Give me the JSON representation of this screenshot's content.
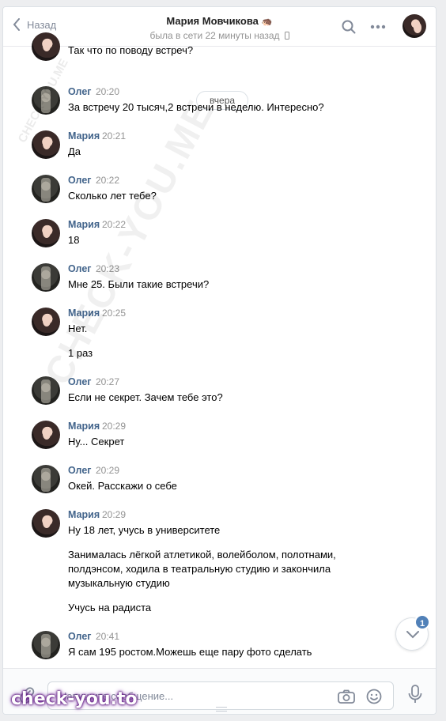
{
  "header": {
    "back_label": "Назад",
    "title": "Мария Мовчикова",
    "title_emoji": "🦔",
    "status": "была в сети 22 минуты назад"
  },
  "date_divider": "вчера",
  "messages": [
    {
      "author": "",
      "time": "",
      "lines": [
        "Так что по поводу встреч?"
      ]
    },
    {
      "author": "Олег",
      "time": "20:20",
      "lines": [
        "За встречу 20 тысяч,2 встречи в неделю. Интересно?"
      ]
    },
    {
      "author": "Мария",
      "time": "20:21",
      "lines": [
        "Да"
      ]
    },
    {
      "author": "Олег",
      "time": "20:22",
      "lines": [
        "Сколько лет тебе?"
      ]
    },
    {
      "author": "Мария",
      "time": "20:22",
      "lines": [
        "18"
      ]
    },
    {
      "author": "Олег",
      "time": "20:23",
      "lines": [
        "Мне 25. Были такие встречи?"
      ]
    },
    {
      "author": "Мария",
      "time": "20:25",
      "lines": [
        "Нет.",
        "1 раз"
      ]
    },
    {
      "author": "Олег",
      "time": "20:27",
      "lines": [
        "Если не секрет. Зачем тебе это?"
      ]
    },
    {
      "author": "Мария",
      "time": "20:29",
      "lines": [
        "Ну... Секрет"
      ]
    },
    {
      "author": "Олег",
      "time": "20:29",
      "lines": [
        "Окей. Расскажи о себе"
      ]
    },
    {
      "author": "Мария",
      "time": "20:29",
      "lines": [
        "Ну 18 лет, учусь в университете",
        "Занималась лёгкой атлетикой, волейболом, полотнами,",
        "полдэнсом, ходила в театральную студию и закончила",
        "музыкальную студию",
        "Учусь на радиста"
      ]
    },
    {
      "author": "Олег",
      "time": "20:41",
      "lines": [
        "Я сам 195 ростом.Можешь еще пару фото сделать"
      ]
    }
  ],
  "unread_badge": "1",
  "composer": {
    "placeholder": "Напишите сообщение..."
  },
  "watermarks": {
    "diagonal": "CHECK-YOU.ME",
    "small": "CHECK-YOU.ME",
    "bottom": "check-you.to"
  },
  "colors": {
    "author_name": "#42648b",
    "badge": "#5181b8",
    "background": "#edeef0"
  }
}
